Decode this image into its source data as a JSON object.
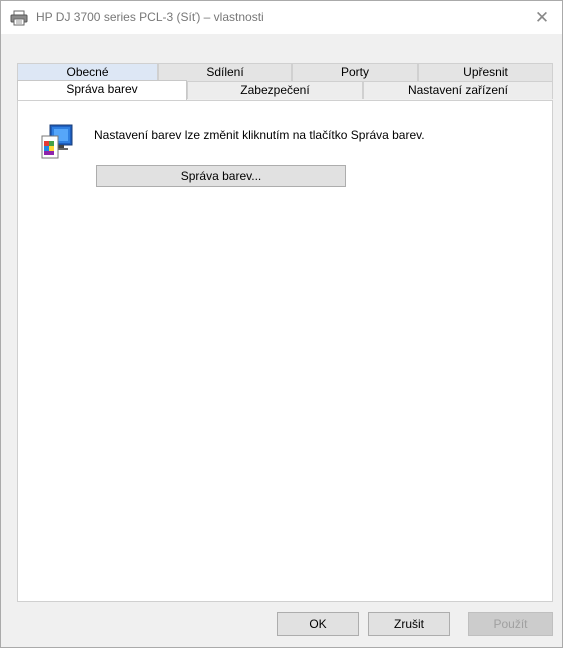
{
  "window": {
    "title": "HP DJ 3700 series PCL-3 (Síť) – vlastnosti",
    "close_glyph": "✕"
  },
  "tabs": {
    "row1": [
      "Obecné",
      "Sdílení",
      "Porty",
      "Upřesnit"
    ],
    "row2": [
      "Správa barev",
      "Zabezpečení",
      "Nastavení zařízení"
    ],
    "active": "Správa barev"
  },
  "panel": {
    "icon": "color-management-icon",
    "message": "Nastavení barev lze změnit kliknutím na tlačítko Správa barev.",
    "color_button_label": "Správa barev..."
  },
  "footer": {
    "ok_label": "OK",
    "cancel_label": "Zrušit",
    "apply_label": "Použít"
  },
  "icons": {
    "title": "printer-icon"
  }
}
